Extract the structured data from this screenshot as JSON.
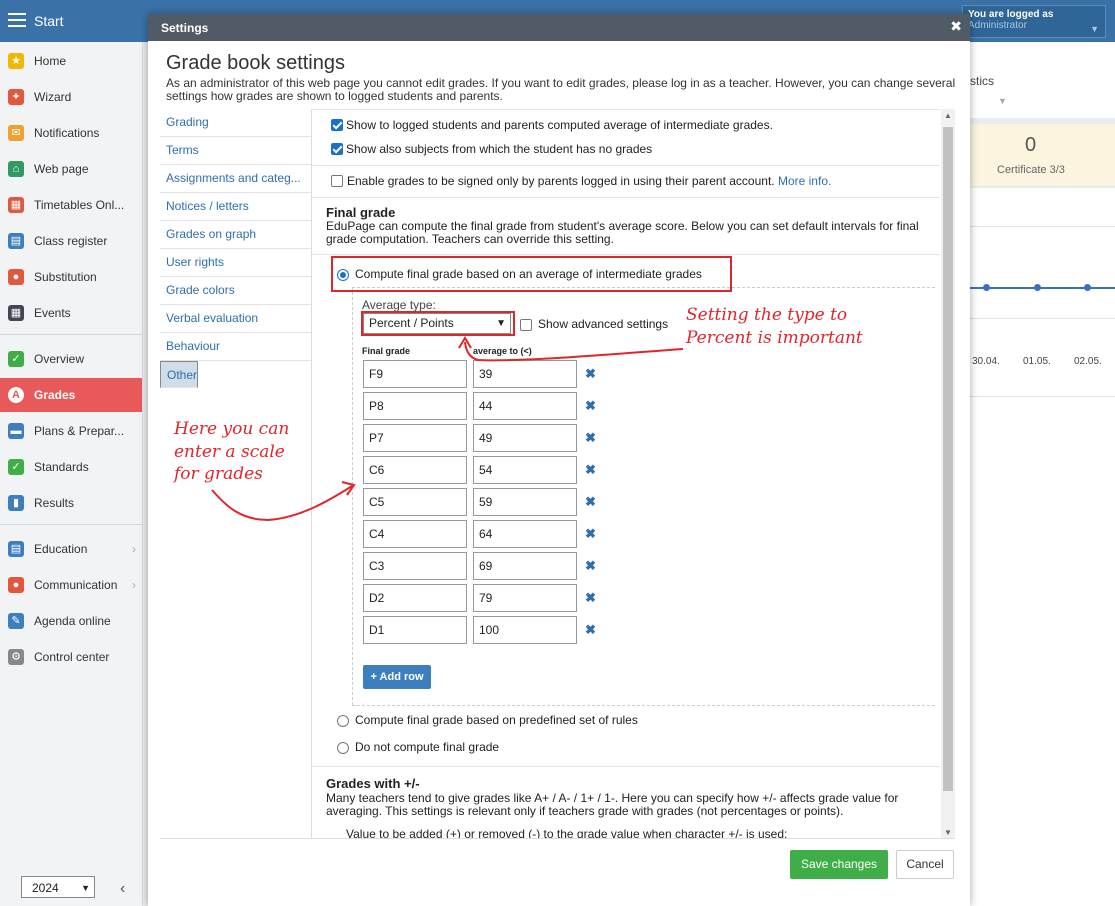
{
  "app": {
    "start_label": "Start",
    "logged_as_label": "You are logged as",
    "logged_user": "Administrator"
  },
  "sidebar": {
    "items": [
      {
        "label": "Home",
        "icon": "star-icon",
        "color": "#f2b705"
      },
      {
        "label": "Wizard",
        "icon": "wand-icon",
        "color": "#e2583e"
      },
      {
        "label": "Notifications",
        "icon": "envelope-icon",
        "color": "#f0a030"
      },
      {
        "label": "Web page",
        "icon": "house-icon",
        "color": "#2e9b63"
      },
      {
        "label": "Timetables Onl...",
        "icon": "grid-icon",
        "color": "#e2583e"
      },
      {
        "label": "Class register",
        "icon": "book-icon",
        "color": "#3d7ebf"
      },
      {
        "label": "Substitution",
        "icon": "person-icon",
        "color": "#e2583e"
      },
      {
        "label": "Events",
        "icon": "calendar-icon",
        "color": "#445"
      },
      {
        "label": "Overview",
        "icon": "check-circle-icon",
        "color": "#3fae49"
      },
      {
        "label": "Grades",
        "icon": "grade-icon",
        "color": "#e85a5a"
      },
      {
        "label": "Plans & Prepar...",
        "icon": "briefcase-icon",
        "color": "#3d7ebf"
      },
      {
        "label": "Standards",
        "icon": "shield-icon",
        "color": "#3fae49"
      },
      {
        "label": "Results",
        "icon": "bar-chart-icon",
        "color": "#3d7ebf"
      },
      {
        "label": "Education",
        "icon": "open-book-icon",
        "color": "#3d7ebf"
      },
      {
        "label": "Communication",
        "icon": "chat-icon",
        "color": "#e2583e"
      },
      {
        "label": "Agenda online",
        "icon": "pen-icon",
        "color": "#3d7ebf"
      },
      {
        "label": "Control center",
        "icon": "gear-icon",
        "color": "#888"
      }
    ],
    "year": "2024"
  },
  "background": {
    "tab_partial": "stics",
    "stat_value": "0",
    "stat_label": "Certificate 3/3",
    "dates": [
      "30.04.",
      "01.05.",
      "02.05."
    ]
  },
  "dialog": {
    "title": "Settings",
    "page_title": "Grade book settings",
    "description": "As an administrator of this web page you cannot edit grades. If you want to edit grades, please log in as a teacher. However, you can change several settings how grades are shown to logged students and parents.",
    "nav": [
      "Grading",
      "Terms",
      "Assignments and categ...",
      "Notices / letters",
      "Grades on graph",
      "User rights",
      "Grade colors",
      "Verbal evaluation",
      "Behaviour",
      "Other"
    ],
    "nav_selected": "Other",
    "options": {
      "show_average": "Show to logged students and parents computed average of intermediate grades.",
      "show_no_grades": "Show also subjects from which the student has no grades",
      "signed_by_parents": "Enable grades to be signed only by parents logged in using their parent account.",
      "more_info": "More info."
    },
    "final_grade": {
      "heading": "Final grade",
      "description": "EduPage can compute the final grade from student's average score. Below you can set default intervals for final grade computation. Teachers can override this setting.",
      "radio_average": "Compute final grade based on an average of intermediate grades",
      "average_type_label": "Average type:",
      "average_type_value": "Percent / Points",
      "show_advanced": "Show advanced settings",
      "col_final": "Final grade",
      "col_average": "average to (<)",
      "rows": [
        {
          "grade": "F9",
          "to": "39"
        },
        {
          "grade": "P8",
          "to": "44"
        },
        {
          "grade": "P7",
          "to": "49"
        },
        {
          "grade": "C6",
          "to": "54"
        },
        {
          "grade": "C5",
          "to": "59"
        },
        {
          "grade": "C4",
          "to": "64"
        },
        {
          "grade": "C3",
          "to": "69"
        },
        {
          "grade": "D2",
          "to": "79"
        },
        {
          "grade": "D1",
          "to": "100"
        }
      ],
      "add_row": "+ Add row",
      "radio_rules": "Compute final grade based on predefined set of rules",
      "radio_none": "Do not compute final grade"
    },
    "plus_minus": {
      "heading": "Grades with +/-",
      "description": "Many teachers tend to give grades like A+ / A- / 1+ / 1-. Here you can specify how +/- affects grade value for averaging. This settings is relevant only if teachers grade with grades (not percentages or points).",
      "value_label": "Value to be added (+) or removed (-) to the grade value when character +/- is used:"
    },
    "save_label": "Save changes",
    "cancel_label": "Cancel"
  },
  "annotations": {
    "type_note_1": "Setting the type to",
    "type_note_2": "Percent is important",
    "scale_note_1": "Here you can",
    "scale_note_2": "enter a scale",
    "scale_note_3": "for grades"
  },
  "colors": {
    "accent": "#3a72a8",
    "active": "#e85a5a",
    "annotation": "#e0252b",
    "save": "#3fae49"
  }
}
